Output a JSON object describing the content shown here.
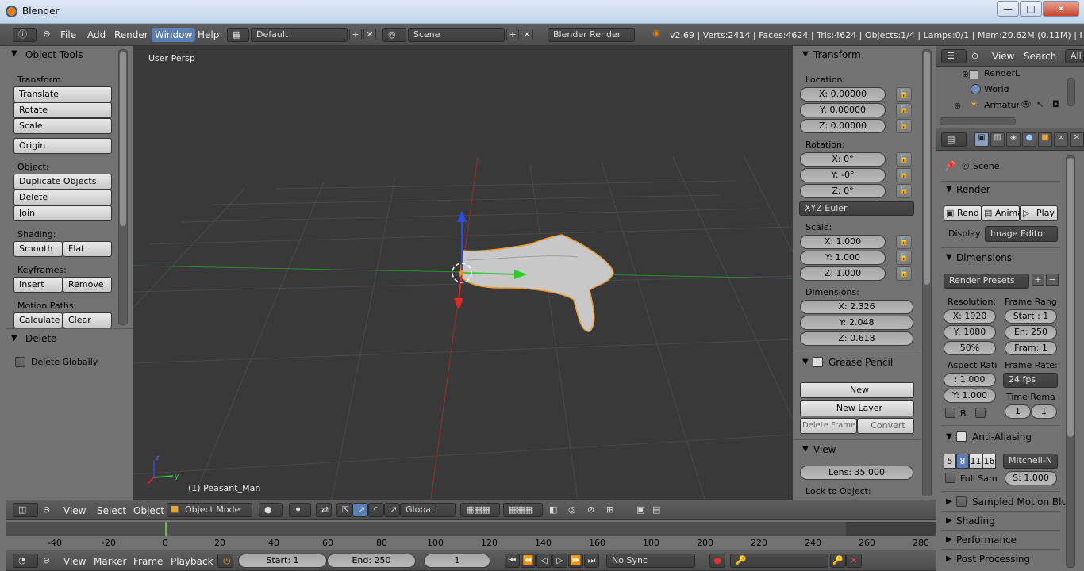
{
  "window": {
    "title": "Blender",
    "min": "—",
    "max": "□",
    "close": "✕"
  },
  "topbar": {
    "menus": [
      "File",
      "Add",
      "Render",
      "Window",
      "Help"
    ],
    "active_menu": "Window",
    "layout": "Default",
    "scene": "Scene",
    "engine": "Blender Render",
    "stats": "v2.69 | Verts:2414 | Faces:4624 | Tris:4624 | Objects:1/4 | Lamps:0/1 | Mem:20.62M (0.11M) | Peasan"
  },
  "tools": {
    "title": "Object Tools",
    "transform_label": "Transform:",
    "translate": "Translate",
    "rotate": "Rotate",
    "scale": "Scale",
    "origin": "Origin",
    "object_label": "Object:",
    "duplicate": "Duplicate Objects",
    "delete": "Delete",
    "join": "Join",
    "shading_label": "Shading:",
    "smooth": "Smooth",
    "flat": "Flat",
    "keyframes_label": "Keyframes:",
    "insert": "Insert",
    "remove": "Remove",
    "motion_label": "Motion Paths:",
    "calculate": "Calculate",
    "clear": "Clear",
    "delete_panel": "Delete",
    "delete_globally": "Delete Globally"
  },
  "viewport": {
    "persp": "User Persp",
    "object_name": "(1) Peasant_Man"
  },
  "properties": {
    "transform_title": "Transform",
    "location_label": "Location:",
    "loc_x": "X: 0.00000",
    "loc_y": "Y: 0.00000",
    "loc_z": "Z: 0.00000",
    "rotation_label": "Rotation:",
    "rot_x": "X: 0°",
    "rot_y": "Y: -0°",
    "rot_z": "Z: 0°",
    "rot_mode": "XYZ Euler",
    "scale_label": "Scale:",
    "sc_x": "X: 1.000",
    "sc_y": "Y: 1.000",
    "sc_z": "Z: 1.000",
    "dim_label": "Dimensions:",
    "dim_x": "X: 2.326",
    "dim_y": "Y: 2.048",
    "dim_z": "Z: 0.618",
    "gp_title": "Grease Pencil",
    "gp_new": "New",
    "gp_new_layer": "New Layer",
    "gp_delete_frame": "Delete Frame",
    "gp_convert": "Convert",
    "view_title": "View",
    "lens": "Lens: 35.000",
    "lock_label": "Lock to Object:"
  },
  "outliner": {
    "view": "View",
    "search": "Search",
    "all": "All",
    "items": [
      "RenderL",
      "World",
      "Armatur"
    ]
  },
  "render_props": {
    "scene": "Scene",
    "render_title": "Render",
    "render_btn": "Rend",
    "anim_btn": "Anima",
    "play_btn": "Play",
    "display_label": "Display",
    "display_value": "Image Editor",
    "dimensions_title": "Dimensions",
    "presets": "Render Presets",
    "resolution_label": "Resolution:",
    "res_x": "X: 1920",
    "res_y": "Y: 1080",
    "res_pct": "50%",
    "frame_range_label": "Frame Rang",
    "start": "Start : 1",
    "end": "En: 250",
    "frame": "Fram: 1",
    "aspect_label": "Aspect Rati",
    "asp_x": ": 1.000",
    "asp_y": "Y: 1.000",
    "frame_rate_label": "Frame Rate:",
    "fps": "24 fps",
    "b_label": "B",
    "time_remap_label": "Time Rema",
    "remap_old": "1",
    "remap_new": "1",
    "aa_title": "Anti-Aliasing",
    "aa_5": "5",
    "aa_8": "8",
    "aa_11": "11",
    "aa_16": "16",
    "aa_filter": "Mitchell-N",
    "full_sample": "Full Sam",
    "filter_size": "S: 1.000",
    "smb_title": "Sampled Motion Blur",
    "shading_title": "Shading",
    "performance_title": "Performance",
    "post_title": "Post Processing"
  },
  "view_header": {
    "view": "View",
    "select": "Select",
    "object": "Object",
    "mode": "Object Mode",
    "orientation": "Global"
  },
  "timeline": {
    "ticks": [
      "-40",
      "-20",
      "0",
      "20",
      "40",
      "60",
      "80",
      "100",
      "120",
      "140",
      "160",
      "180",
      "200",
      "220",
      "240",
      "260",
      "280"
    ],
    "view": "View",
    "marker": "Marker",
    "frame": "Frame",
    "playback": "Playback",
    "start": "Start: 1",
    "end": "End: 250",
    "current": "1",
    "sync": "No Sync"
  }
}
